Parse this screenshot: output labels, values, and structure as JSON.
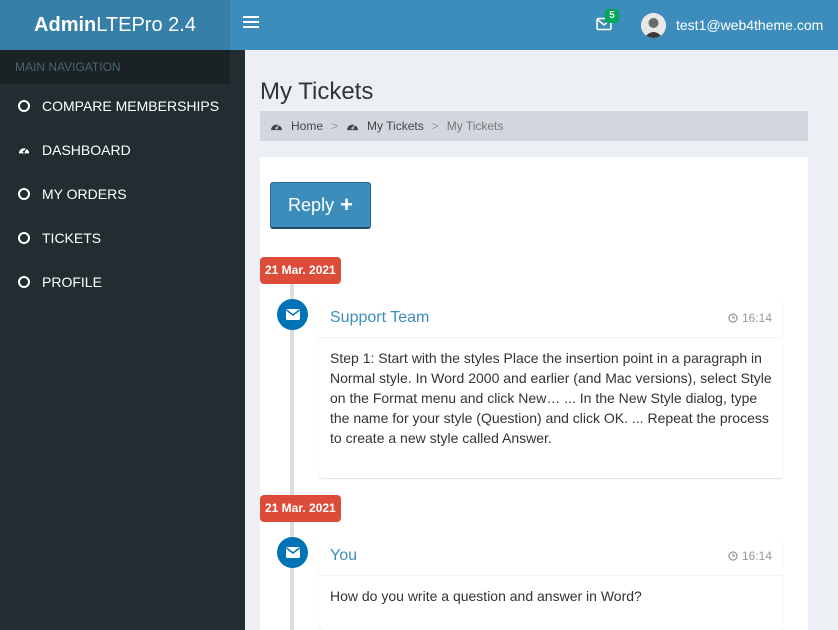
{
  "header": {
    "logo_bold": "Admin",
    "logo_light": "LTEPro 2.4",
    "mail_count": "5",
    "user_email": "test1@web4theme.com"
  },
  "sidebar": {
    "section_header": "MAIN NAVIGATION",
    "items": [
      {
        "label": "COMPARE MEMBERSHIPS",
        "icon": "circle-icon"
      },
      {
        "label": "DASHBOARD",
        "icon": "dashboard-icon"
      },
      {
        "label": "MY ORDERS",
        "icon": "circle-icon"
      },
      {
        "label": "TICKETS",
        "icon": "circle-icon"
      },
      {
        "label": "PROFILE",
        "icon": "circle-icon"
      }
    ]
  },
  "page": {
    "title": "My Tickets",
    "breadcrumb": [
      {
        "label": "Home",
        "icon": "dashboard-icon"
      },
      {
        "label": "My Tickets",
        "icon": "dashboard-icon"
      },
      {
        "label": "My Tickets"
      }
    ],
    "reply_label": "Reply"
  },
  "timeline": [
    {
      "date": "21 Mar. 2021",
      "author": "Support Team",
      "time": "16:14",
      "body": "Step 1: Start with the styles Place the insertion point in a paragraph in Normal style. In Word 2000 and earlier (and Mac versions), select Style on the Format menu and click New… ... In the New Style dialog, type the name for your style (Question) and click OK. ... Repeat the process to create a new style called Answer."
    },
    {
      "date": "21 Mar. 2021",
      "author": "You",
      "time": "16:14",
      "body": "How do you write a question and answer in Word?"
    }
  ],
  "colors": {
    "header": "#3c8dbc",
    "logo_bg": "#367fa9",
    "sidebar": "#222d32",
    "date_label": "#dd4b39",
    "timeline_icon": "#0073b7",
    "badge": "#00a65a"
  }
}
